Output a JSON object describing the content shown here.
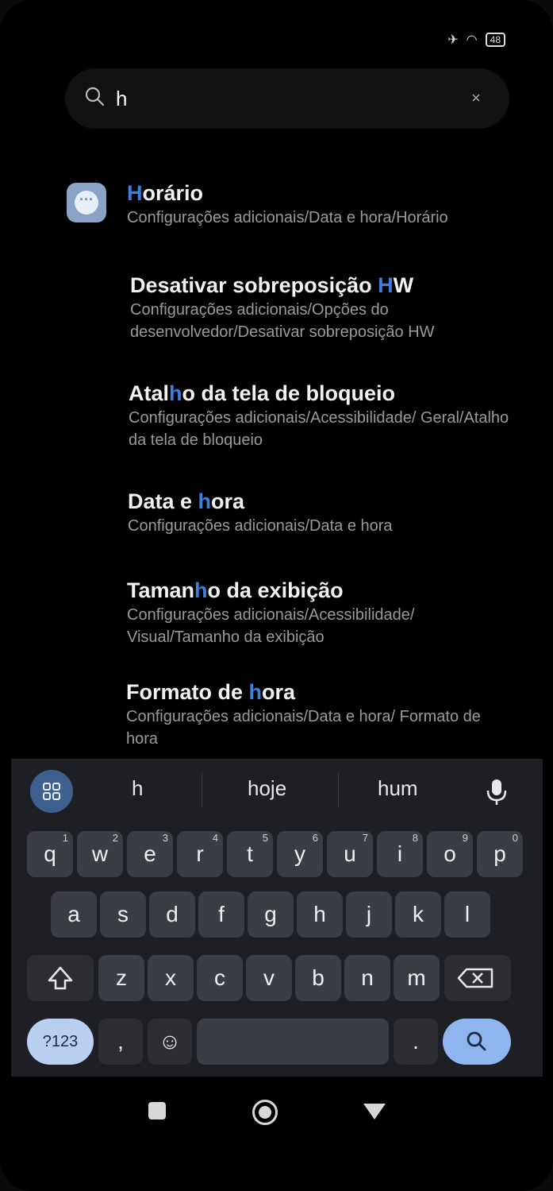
{
  "status": {
    "battery": "48"
  },
  "search": {
    "query": "h",
    "clear_label": "×"
  },
  "results": [
    {
      "title_pre": "",
      "title_hl": "H",
      "title_post": "orário",
      "path": "Configurações adicionais/Data e hora/Horário"
    },
    {
      "title_pre": "Desativar sobreposição ",
      "title_hl": "H",
      "title_post": "W",
      "path": "Configurações adicionais/Opções do desenvolvedor/Desativar sobreposição HW"
    },
    {
      "title_pre": "Atal",
      "title_hl": "h",
      "title_post": "o da tela de bloqueio",
      "path": "Configurações adicionais/Acessibilidade/ Geral/Atalho da tela de bloqueio"
    },
    {
      "title_pre": "Data e ",
      "title_hl": "h",
      "title_post": "ora",
      "path": "Configurações adicionais/Data e hora"
    },
    {
      "title_pre": "Taman",
      "title_hl": "h",
      "title_post": "o da exibição",
      "path": "Configurações adicionais/Acessibilidade/ Visual/Tamanho da exibição"
    },
    {
      "title_pre": "Formato de ",
      "title_hl": "h",
      "title_post": "ora",
      "path": "Configurações adicionais/Data e hora/ Formato de hora"
    }
  ],
  "keyboard": {
    "suggestions": [
      "h",
      "hoje",
      "hum"
    ],
    "row1": [
      "q",
      "w",
      "e",
      "r",
      "t",
      "y",
      "u",
      "i",
      "o",
      "p"
    ],
    "row1_sup": [
      "1",
      "2",
      "3",
      "4",
      "5",
      "6",
      "7",
      "8",
      "9",
      "0"
    ],
    "row2": [
      "a",
      "s",
      "d",
      "f",
      "g",
      "h",
      "j",
      "k",
      "l"
    ],
    "row3": [
      "z",
      "x",
      "c",
      "v",
      "b",
      "n",
      "m"
    ],
    "symbols_label": "?123",
    "comma": ",",
    "period": ".",
    "emoji": "☺"
  },
  "colors": {
    "highlight": "#3d7fe0",
    "keyboard_bg": "#1d1f24"
  }
}
